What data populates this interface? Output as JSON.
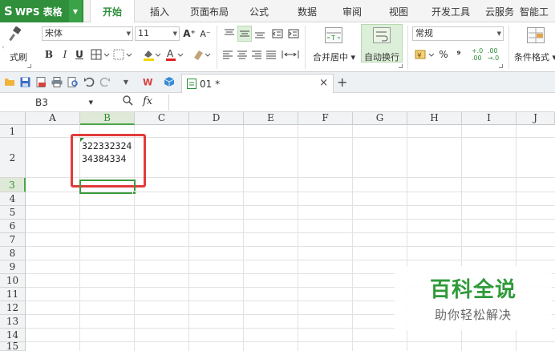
{
  "app": {
    "logo_text": "WPS 表格",
    "menu_tabs": [
      "开始",
      "插入",
      "页面布局",
      "公式",
      "数据",
      "审阅",
      "视图",
      "开发工具",
      "云服务",
      "智能工"
    ]
  },
  "ribbon": {
    "format_painter_label": "式刷",
    "font_name": "宋体",
    "font_size": "11",
    "grow_font": "A⁺",
    "shrink_font": "A⁻",
    "bold": "B",
    "italic": "I",
    "underline": "U",
    "merge_center_label": "合并居中",
    "wrap_text_label": "自动换行",
    "number_format": "常规",
    "percent": "%",
    "comma": "⁹",
    "inc_decimal": "+.0\n.00",
    "dec_decimal": ".00\n→.0",
    "conditional_format_label": "条件格式"
  },
  "tabs": {
    "doc_name": "01 *",
    "close_glyph": "×",
    "add_glyph": "+"
  },
  "formula_bar": {
    "cell_ref": "B3",
    "fx": "fx",
    "value": ""
  },
  "grid": {
    "columns": [
      "A",
      "B",
      "C",
      "D",
      "E",
      "F",
      "G",
      "H",
      "I",
      "J"
    ],
    "rows": [
      "1",
      "2",
      "3",
      "4",
      "5",
      "6",
      "7",
      "8",
      "9",
      "10",
      "11",
      "12",
      "13",
      "14",
      "15"
    ],
    "selected_column": "B",
    "selected_row": "3",
    "cell_b2_text": "32233232434384334"
  },
  "watermark": {
    "title": "百科全说",
    "subtitle": "助你轻松解决"
  },
  "colors": {
    "brand_green": "#2f8f3b",
    "annotation_red": "#e23b3b"
  }
}
